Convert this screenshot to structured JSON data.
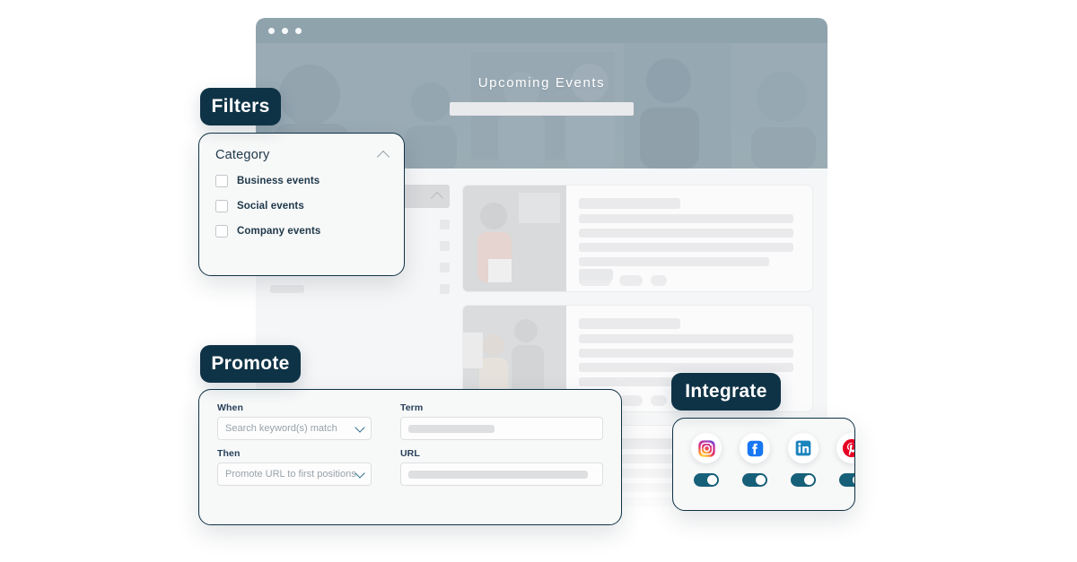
{
  "browser": {
    "window_dots": 3,
    "hero": {
      "title": "Upcoming Events",
      "search_placeholder": ""
    }
  },
  "badges": {
    "filters": "Filters",
    "promote": "Promote",
    "integrate": "Integrate"
  },
  "filters_panel": {
    "group_title": "Category",
    "collapse_icon": "chevron-up-icon",
    "options": [
      {
        "label": "Business events",
        "checked": false
      },
      {
        "label": "Social events",
        "checked": false
      },
      {
        "label": "Company events",
        "checked": false
      }
    ]
  },
  "promote_panel": {
    "fields": [
      {
        "label": "When",
        "type": "select",
        "value": "",
        "placeholder": "Search keyword(s) match"
      },
      {
        "label": "Term",
        "type": "text",
        "value": "",
        "placeholder": ""
      },
      {
        "label": "Then",
        "type": "select",
        "value": "",
        "placeholder": "Promote URL to first positions"
      },
      {
        "label": "URL",
        "type": "text",
        "value": "",
        "placeholder": ""
      }
    ]
  },
  "integrate_panel": {
    "channels": [
      {
        "name": "Instagram",
        "icon": "instagram-icon",
        "color": "#E1306C",
        "enabled": true
      },
      {
        "name": "Facebook",
        "icon": "facebook-icon",
        "color": "#1877F2",
        "enabled": true
      },
      {
        "name": "LinkedIn",
        "icon": "linkedin-icon",
        "color": "#0A66C2",
        "enabled": true
      },
      {
        "name": "Pinterest",
        "icon": "pinterest-icon",
        "color": "#E60023",
        "enabled": true
      }
    ]
  },
  "theme": {
    "badge_bg": "#0f3346",
    "panel_border": "#0f3346",
    "toggle_on": "#176079",
    "browser_bar": "#8fa3ad",
    "page_bg": "#f5f6f7"
  }
}
